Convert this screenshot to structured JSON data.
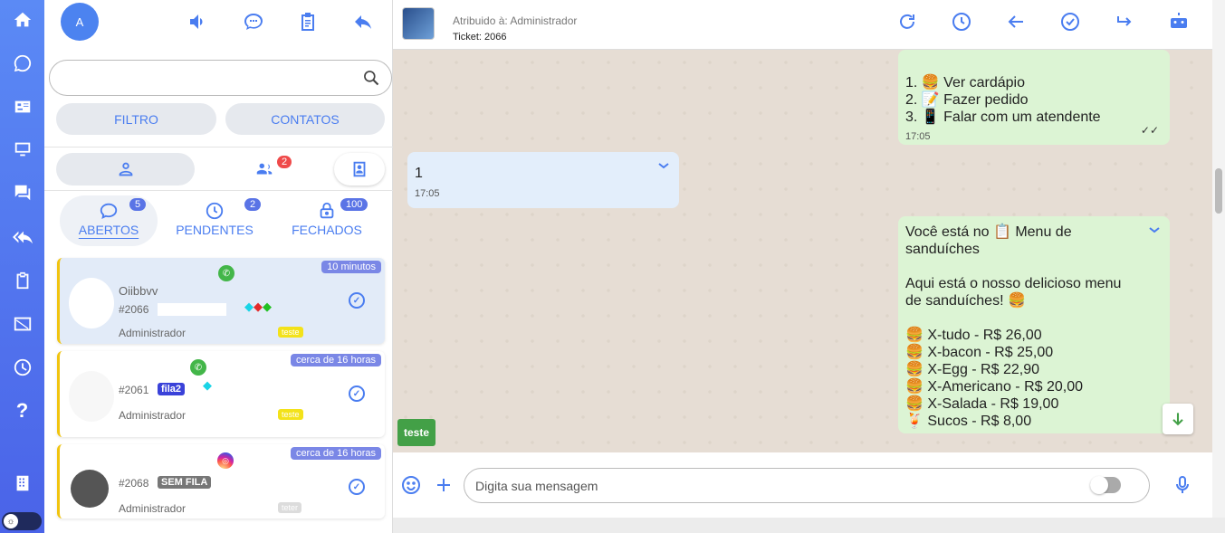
{
  "rail": {
    "items": [
      "home-icon",
      "whatsapp-icon",
      "contacts-card-icon",
      "monitor-icon",
      "chat-bubbles-icon",
      "reply-all-icon",
      "clipboard-icon",
      "news-off-icon",
      "clock-icon",
      "help-icon",
      "building-icon"
    ],
    "help_glyph": "?"
  },
  "sidebar": {
    "avatar_letter": "A",
    "search_placeholder": "",
    "filter_label": "FILTRO",
    "contacts_label": "CONTATOS",
    "group_badge": "2",
    "tabs": [
      {
        "label": "ABERTOS",
        "count": "5"
      },
      {
        "label": "PENDENTES",
        "count": "2"
      },
      {
        "label": "FECHADOS",
        "count": "100"
      }
    ],
    "tickets": [
      {
        "time": "10 minutos",
        "message": "Oiibbvv",
        "number": "#2066",
        "agent": "Administrador",
        "queue_tag": "teste",
        "queue": ""
      },
      {
        "time": "cerca de 16 horas",
        "message": "",
        "number": "#2061",
        "agent": "Administrador",
        "queue_tag": "teste",
        "queue": "fila2"
      },
      {
        "time": "cerca de 16 horas",
        "message": "",
        "number": "#2068",
        "agent": "Administrador",
        "queue_tag": "teter",
        "queue": "SEM FILA"
      }
    ]
  },
  "chat": {
    "assigned": "Atribuido à: Administrador",
    "ticket": "Ticket: 2066",
    "messages": {
      "m1_lines": [
        "1. 🍔 Ver cardápio",
        "2. 📝 Fazer pedido",
        "3. 📱 Falar com um atendente"
      ],
      "m1_time": "17:05",
      "m2_text": "1",
      "m2_time": "17:05",
      "m3_lines": [
        "Você está no 📋 Menu de",
        "sanduíches",
        "",
        "Aqui está o nosso delicioso menu",
        "de sanduíches! 🍔",
        "",
        "🍔 X-tudo - R$ 26,00",
        "🍔 X-bacon - R$ 25,00",
        "🍔 X-Egg - R$ 22,90",
        "🍔 X-Americano - R$ 20,00",
        "🍔 X-Salada - R$ 19,00",
        "🍹 Sucos - R$ 8,00"
      ]
    },
    "tag": "teste",
    "input_placeholder": "Digita sua mensagem"
  }
}
